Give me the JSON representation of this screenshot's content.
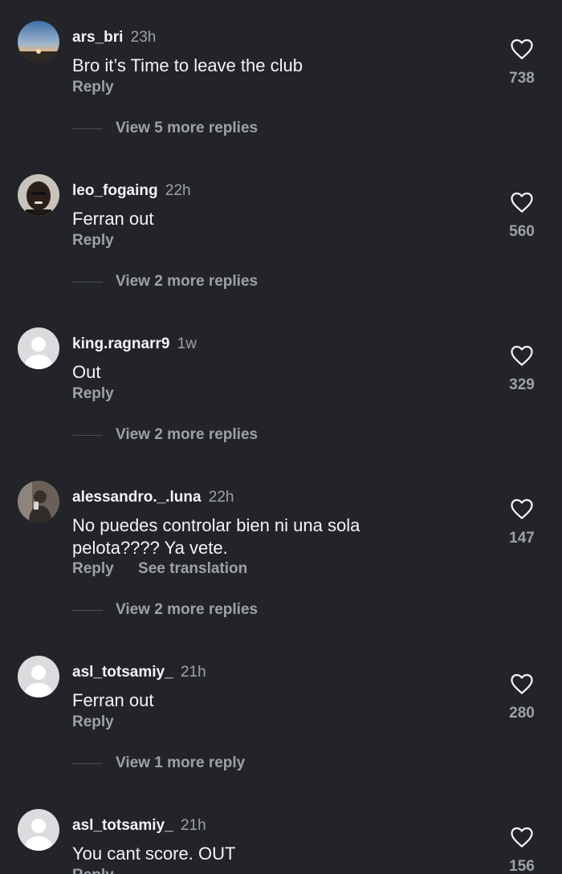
{
  "comments": [
    {
      "username": "ars_bri",
      "time": "23h",
      "text": "Bro it’s Time to leave the club",
      "reply_label": "Reply",
      "translate_label": "",
      "view_replies": "View 5 more replies",
      "likes": "738",
      "avatar": "sunset-photo"
    },
    {
      "username": "leo_fogaing",
      "time": "22h",
      "text": "Ferran out",
      "reply_label": "Reply",
      "translate_label": "",
      "view_replies": "View 2 more replies",
      "likes": "560",
      "avatar": "person-photo"
    },
    {
      "username": "king.ragnarr9",
      "time": "1w",
      "text": "Out",
      "reply_label": "Reply",
      "translate_label": "",
      "view_replies": "View 2 more replies",
      "likes": "329",
      "avatar": "default-avatar"
    },
    {
      "username": "alessandro._.luna",
      "time": "22h",
      "text": "No puedes controlar bien ni una sola pelota???? Ya vete.",
      "reply_label": "Reply",
      "translate_label": "See translation",
      "view_replies": "View 2 more replies",
      "likes": "147",
      "avatar": "mirror-selfie-photo"
    },
    {
      "username": "asl_totsamiy_",
      "time": "21h",
      "text": "Ferran out",
      "reply_label": "Reply",
      "translate_label": "",
      "view_replies": "View 1 more reply",
      "likes": "280",
      "avatar": "default-avatar"
    },
    {
      "username": "asl_totsamiy_",
      "time": "21h",
      "text": "You cant score. OUT",
      "reply_label": "Reply",
      "translate_label": "",
      "view_replies": "",
      "likes": "156",
      "avatar": "default-avatar"
    }
  ],
  "icons": {
    "like": "heart-outline-icon"
  },
  "colors": {
    "background": "#222429",
    "primary_text": "#f4f4f4",
    "secondary_text": "#9ea1a8"
  }
}
